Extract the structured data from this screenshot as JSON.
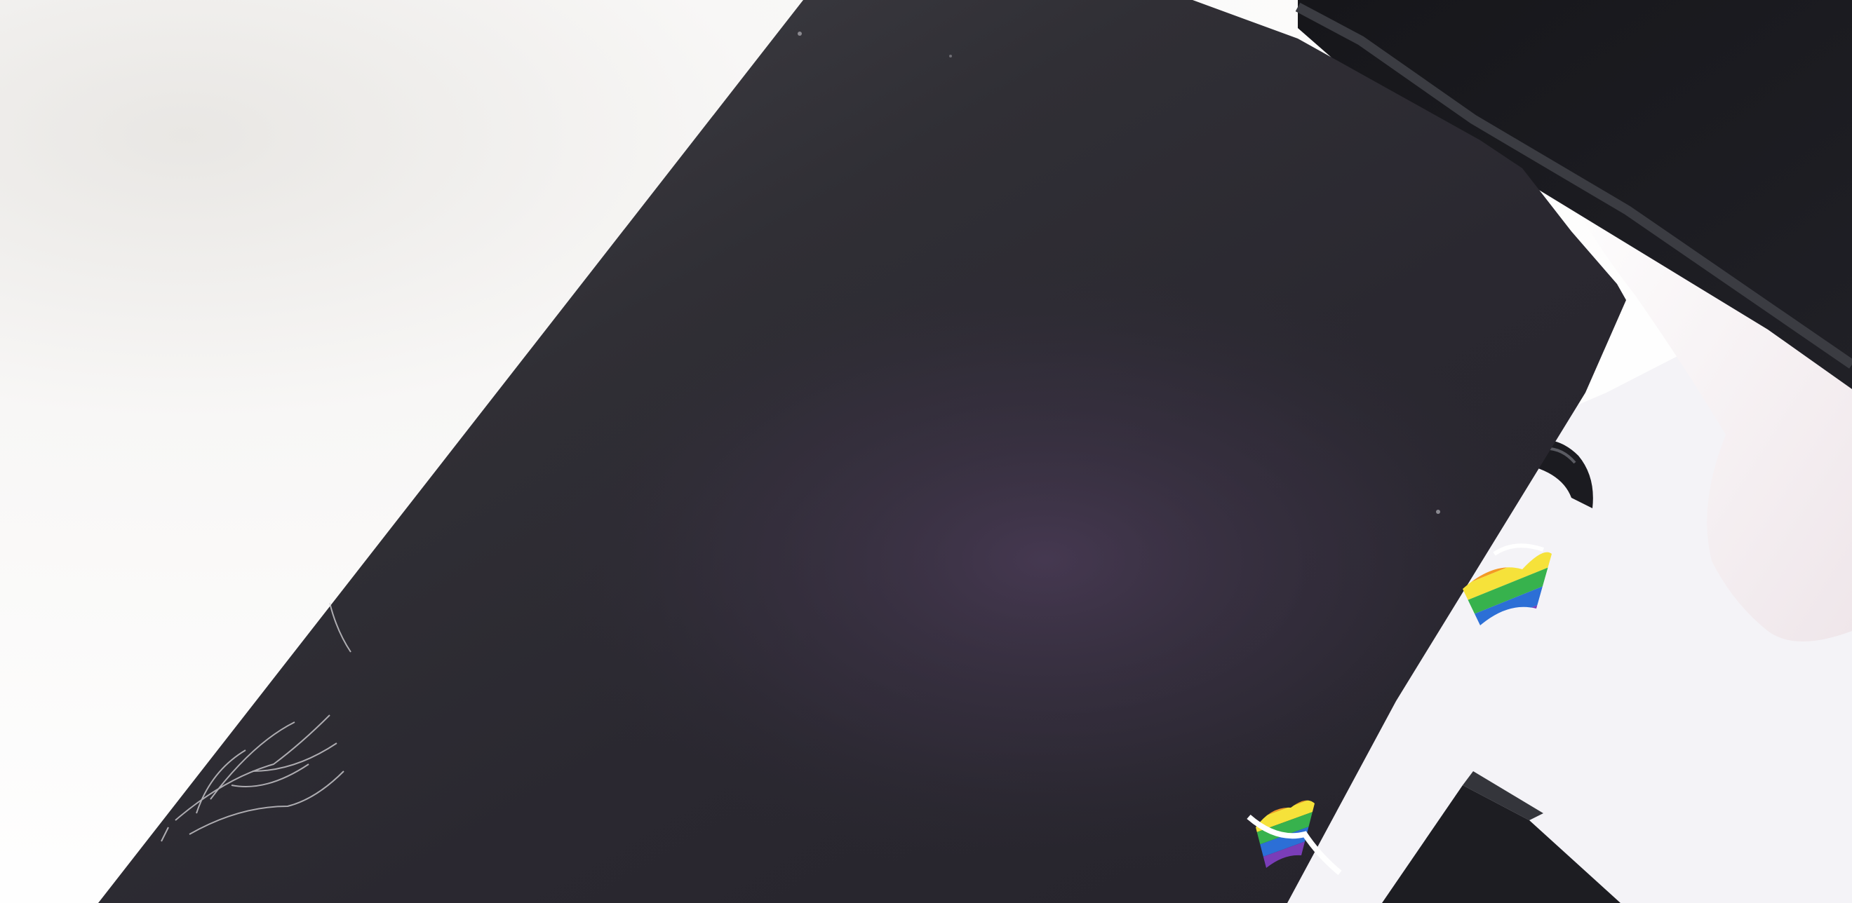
{
  "scene": {
    "subject": "photo",
    "colors": {
      "wall": "#f5f4f3",
      "wall_shadow": "#e8e7e6",
      "surface": "#f6f5f8",
      "panel_dark": "#2a2930",
      "panel_mid": "#37353d",
      "panel_purple": "#3d3346",
      "bezel": "#1d1d22",
      "bezel_edge": "#3a3b40",
      "fabric": "#f7f2f4",
      "flag_red": "#e63a2e",
      "flag_orange": "#f39a25",
      "flag_yellow": "#f6e23a",
      "flag_green": "#37b24d",
      "flag_blue": "#2c6fd6",
      "flag_purple": "#7a3db8"
    },
    "icons": {
      "flag_upper": "rainbow-flag-icon",
      "flag_lower": "rainbow-flag-icon"
    }
  }
}
